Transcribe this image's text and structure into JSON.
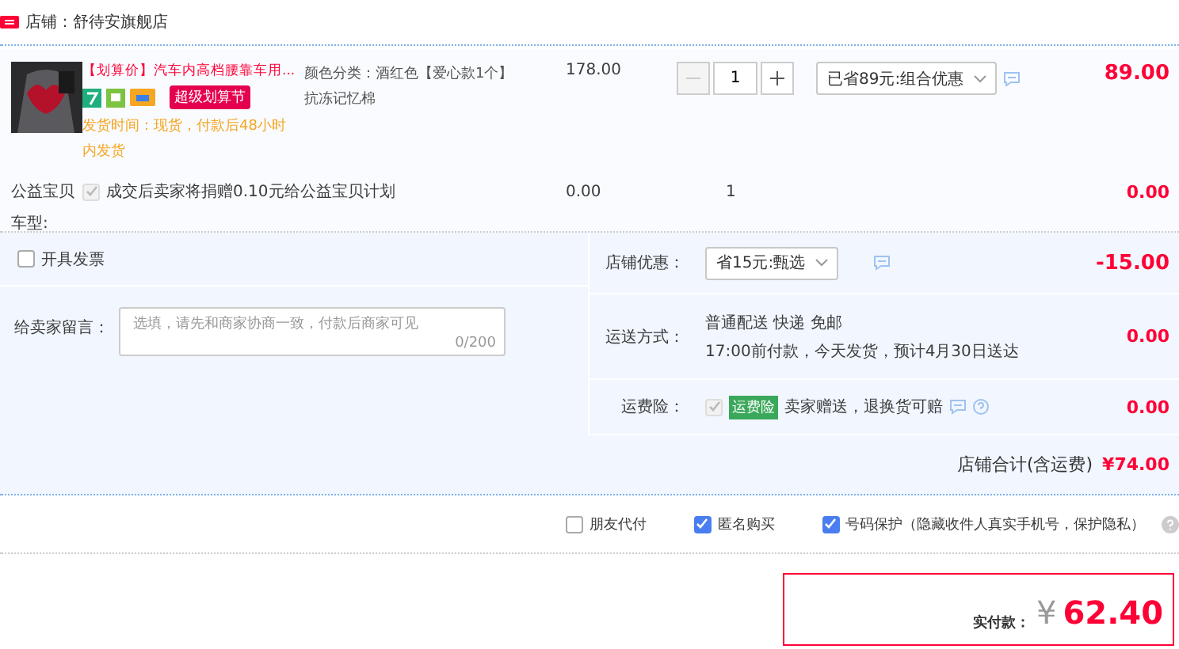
{
  "shop": {
    "name": "店铺：舒待安旗舰店"
  },
  "item": {
    "title": "【划算价】汽车内高档腰靠车用...",
    "promo_tag": "超级划算节",
    "shipping_note": "发货时间：现货，付款后48小时内发货",
    "sku": [
      "颜色分类：酒红色【爱心款1个】",
      "抗冻记忆棉"
    ],
    "price": "178.00",
    "quantity": "1",
    "discount_select": "已省89元:组合优惠",
    "subtotal": "89.00"
  },
  "charity": {
    "label": "公益宝贝",
    "checked": true,
    "disabled": true,
    "text": "成交后卖家将捐赠0.10元给公益宝贝计划",
    "price": "0.00",
    "quantity": "1",
    "subtotal": "0.00"
  },
  "car_model": {
    "label": "车型:"
  },
  "invoice": {
    "label": "开具发票",
    "checked": false
  },
  "message": {
    "label": "给卖家留言：",
    "placeholder": "选填，请先和商家协商一致，付款后商家可见",
    "counter": "0/200"
  },
  "shop_discount": {
    "label": "店铺优惠：",
    "select": "省15元:甄选",
    "amount": "-15.00"
  },
  "shipping": {
    "label": "运送方式：",
    "method": "普通配送 快递 免邮",
    "eta": "17:00前付款，今天发货，预计4月30日送达",
    "amount": "0.00"
  },
  "insurance": {
    "label": "运费险：",
    "checked": true,
    "disabled": true,
    "tag": "运费险",
    "text": "卖家赠送，退换货可赔",
    "amount": "0.00"
  },
  "shop_total": {
    "label": "店铺合计(含运费)",
    "amount": "¥74.00"
  },
  "options": [
    {
      "label": "朋友代付",
      "checked": false
    },
    {
      "label": "匿名购买",
      "checked": true
    },
    {
      "label": "号码保护（隐藏收件人真实手机号，保护隐私）",
      "checked": true
    }
  ],
  "payment": {
    "label": "实付款：",
    "currency": "¥",
    "amount": "62.40"
  }
}
